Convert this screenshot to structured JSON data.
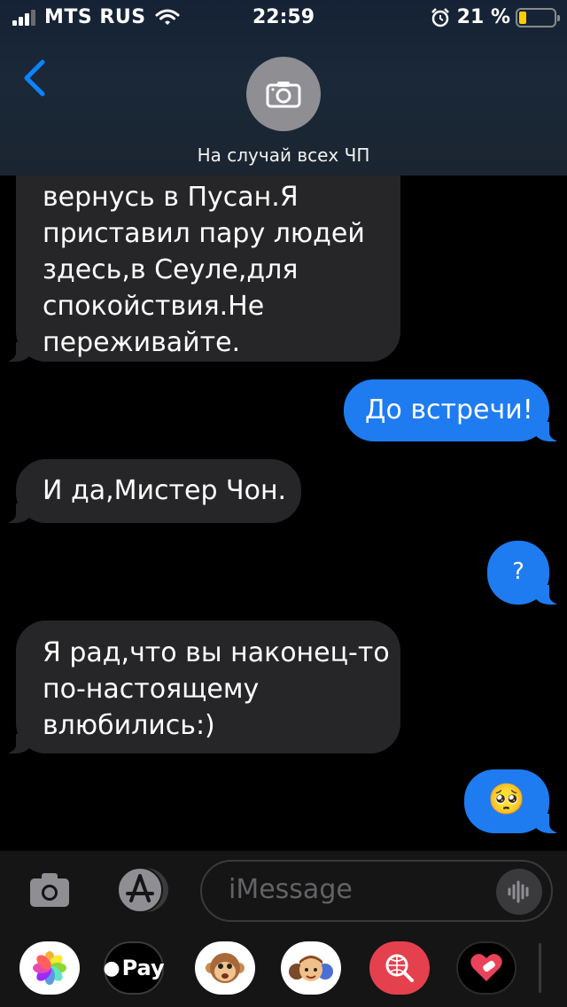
{
  "status_bar": {
    "carrier": "MTS RUS",
    "time": "22:59",
    "battery_percent": "21 %",
    "battery_level": 0.21,
    "signal_bars": 3,
    "signal_bars_total": 4
  },
  "header": {
    "contact_name": "На случай всех ЧП",
    "back_icon": "chevron-left-icon",
    "avatar_icon": "camera-icon"
  },
  "messages": [
    {
      "direction": "incoming",
      "text": "вернусь в Пусан.Я\nприставил пару людей\nздесь,в Сеуле,для\nспокойствия.Не\nпереживайте."
    },
    {
      "direction": "outgoing",
      "text": "До встречи!"
    },
    {
      "direction": "incoming",
      "text": "И да,Мистер Чон."
    },
    {
      "direction": "outgoing",
      "text": "?"
    },
    {
      "direction": "incoming",
      "text": "Я рад,что вы наконец-то\nпо-настоящему\nвлюбились:)"
    },
    {
      "direction": "outgoing",
      "text": "🥺"
    }
  ],
  "input_bar": {
    "placeholder": "iMessage",
    "camera_icon": "camera-icon",
    "apps_icon": "app-store-icon",
    "audio_icon": "audio-waveform-icon"
  },
  "app_drawer": {
    "apps": [
      {
        "name": "Photos",
        "icon": "photos-icon"
      },
      {
        "name": "Apple Pay",
        "label": "Pay",
        "icon": "apple-pay-icon"
      },
      {
        "name": "Animoji",
        "icon": "monkey-animoji-icon"
      },
      {
        "name": "Memoji Stickers",
        "icon": "memoji-icon"
      },
      {
        "name": "Images",
        "icon": "globe-search-icon"
      },
      {
        "name": "Digital Touch",
        "icon": "heart-touch-icon"
      }
    ]
  },
  "colors": {
    "outgoing_bubble": "#1e7cf0",
    "incoming_bubble": "#262628",
    "accent": "#0a84ff",
    "battery_low": "#ffcc00"
  }
}
